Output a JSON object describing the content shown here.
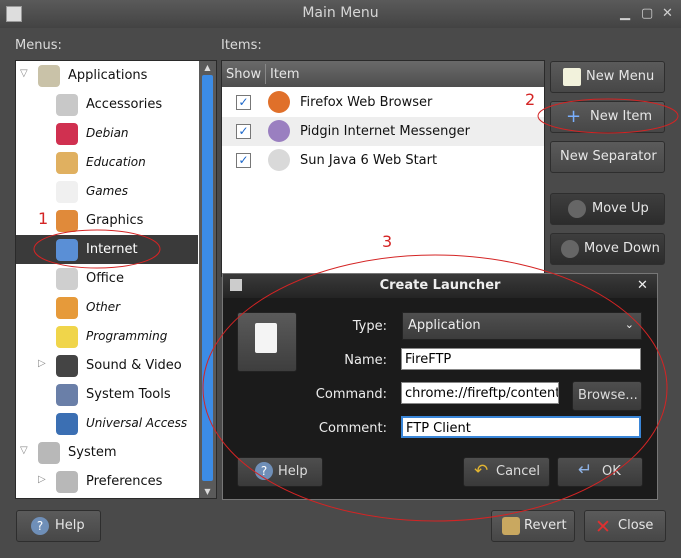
{
  "window": {
    "title": "Main Menu",
    "menus_label": "Menus:",
    "items_label": "Items:"
  },
  "menus": [
    {
      "label": "Applications",
      "expander": "▽",
      "icon": "applications-icon",
      "level": 0,
      "italic": false
    },
    {
      "label": "Accessories",
      "icon": "accessories-icon",
      "level": 1,
      "italic": false
    },
    {
      "label": "Debian",
      "icon": "debian-icon",
      "level": 1,
      "italic": true
    },
    {
      "label": "Education",
      "icon": "education-icon",
      "level": 1,
      "italic": true
    },
    {
      "label": "Games",
      "icon": "games-icon",
      "level": 1,
      "italic": true
    },
    {
      "label": "Graphics",
      "icon": "graphics-icon",
      "level": 1,
      "italic": false
    },
    {
      "label": "Internet",
      "icon": "internet-icon",
      "level": 1,
      "italic": false,
      "selected": true
    },
    {
      "label": "Office",
      "icon": "office-icon",
      "level": 1,
      "italic": false
    },
    {
      "label": "Other",
      "icon": "other-icon",
      "level": 1,
      "italic": true
    },
    {
      "label": "Programming",
      "icon": "programming-icon",
      "level": 1,
      "italic": true
    },
    {
      "label": "Sound & Video",
      "expander": "▷",
      "icon": "sound-video-icon",
      "level": 1,
      "italic": false
    },
    {
      "label": "System Tools",
      "icon": "system-tools-icon",
      "level": 1,
      "italic": false
    },
    {
      "label": "Universal Access",
      "icon": "universal-access-icon",
      "level": 1,
      "italic": true
    },
    {
      "label": "System",
      "expander": "▽",
      "icon": "system-icon",
      "level": 0,
      "italic": false
    },
    {
      "label": "Preferences",
      "expander": "▷",
      "icon": "preferences-icon",
      "level": 1,
      "italic": false
    }
  ],
  "items_table": {
    "col_show": "Show",
    "col_item": "Item",
    "rows": [
      {
        "checked": true,
        "label": "Firefox Web Browser",
        "icon": "firefox-icon"
      },
      {
        "checked": true,
        "label": "Pidgin Internet Messenger",
        "icon": "pidgin-icon"
      },
      {
        "checked": true,
        "label": "Sun Java 6 Web Start",
        "icon": "java-icon"
      }
    ]
  },
  "buttons": {
    "new_menu": "New Menu",
    "new_item": "New Item",
    "new_separator": "New Separator",
    "move_up": "Move Up",
    "move_down": "Move Down",
    "help": "Help",
    "revert": "Revert",
    "close": "Close"
  },
  "dialog": {
    "title": "Create Launcher",
    "type_label": "Type:",
    "type_value": "Application",
    "name_label": "Name:",
    "name_value": "FireFTP",
    "command_label": "Command:",
    "command_value": "chrome://fireftp/content/",
    "browse_label": "Browse...",
    "comment_label": "Comment:",
    "comment_value": "FTP Client",
    "help_label": "Help",
    "cancel_label": "Cancel",
    "ok_label": "OK"
  },
  "annotations": {
    "one": "1",
    "two": "2",
    "three": "3"
  },
  "colors": {
    "annotation": "#d42424",
    "selection": "#3a3a3a",
    "scroll_thumb": "#3c8ce6"
  }
}
